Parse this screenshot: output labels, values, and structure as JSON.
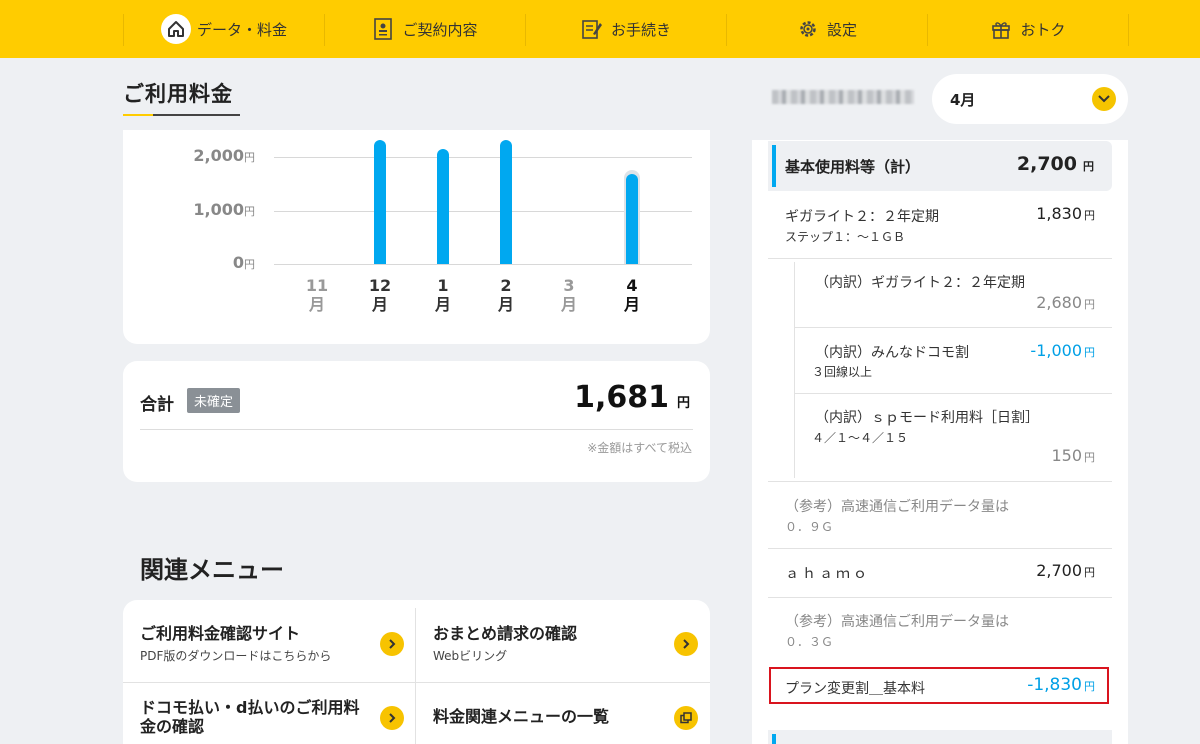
{
  "nav": {
    "items": [
      {
        "label": "データ・料金",
        "icon": "home-icon"
      },
      {
        "label": "ご契約内容",
        "icon": "contract-icon"
      },
      {
        "label": "お手続き",
        "icon": "procedure-icon"
      },
      {
        "label": "設定",
        "icon": "gear-icon"
      },
      {
        "label": "おトク",
        "icon": "gift-icon"
      }
    ],
    "active": "データ・料金"
  },
  "page": {
    "title": "ご利用料金"
  },
  "month_select": {
    "value": "4月"
  },
  "chart_data": {
    "type": "bar",
    "categories": [
      "11月",
      "12月",
      "1月",
      "2月",
      "3月",
      "4月"
    ],
    "values": [
      0,
      2700,
      2150,
      2700,
      0,
      1681
    ],
    "ytick_labels": [
      "2,000",
      "1,000",
      "0"
    ],
    "yunit": "円",
    "yticks": [
      2000,
      1000,
      0
    ],
    "ylim": [
      0,
      2200
    ],
    "current": "4月",
    "xlabels": [
      [
        "11",
        "月"
      ],
      [
        "12",
        "月"
      ],
      [
        "1",
        "月"
      ],
      [
        "2",
        "月"
      ],
      [
        "3",
        "月"
      ],
      [
        "4",
        "月"
      ]
    ]
  },
  "total": {
    "label": "合計",
    "badge": "未確定",
    "value": "1,681",
    "unit": "円",
    "note": "※金額はすべて税込"
  },
  "related": {
    "heading": "関連メニュー",
    "items": [
      {
        "title": "ご利用料金確認サイト",
        "sub": "PDF版のダウンロードはこちらから",
        "icon": "chevron-right-icon"
      },
      {
        "title": "おまとめ請求の確認",
        "sub": "Webビリング",
        "icon": "chevron-right-icon"
      },
      {
        "title_line1": "ドコモ払い・d払いのご利用料",
        "title_line2": "金の確認",
        "icon": "chevron-right-icon"
      },
      {
        "title": "料金関連メニューの一覧",
        "icon": "copy-icon"
      }
    ]
  },
  "detail": {
    "header": {
      "label": "基本使用料等（計）",
      "value": "2,700",
      "unit": "円"
    },
    "rows": [
      {
        "label": "ギガライト２：２年定期",
        "sub": "ステップ１：～１ＧＢ",
        "value": "1,830",
        "unit": "円"
      },
      {
        "label": "（内訳）ギガライト２：２年定期",
        "value": "2,680",
        "unit": "円"
      },
      {
        "label": "（内訳）みんなドコモ割",
        "sub": "３回線以上",
        "value": "-1,000",
        "unit": "円"
      },
      {
        "label": "（内訳）ｓｐモード利用料［日割］",
        "sub": "４／１～４／１５",
        "value": "150",
        "unit": "円"
      },
      {
        "label": "（参考）高速通信ご利用データ量は",
        "sub": "０．９Ｇ"
      },
      {
        "label": "ａｈａｍｏ",
        "value": "2,700",
        "unit": "円"
      },
      {
        "label": "（参考）高速通信ご利用データ量は",
        "sub": "０．３Ｇ"
      },
      {
        "label": "プラン変更割＿基本料",
        "value": "-1,830",
        "unit": "円"
      }
    ]
  }
}
